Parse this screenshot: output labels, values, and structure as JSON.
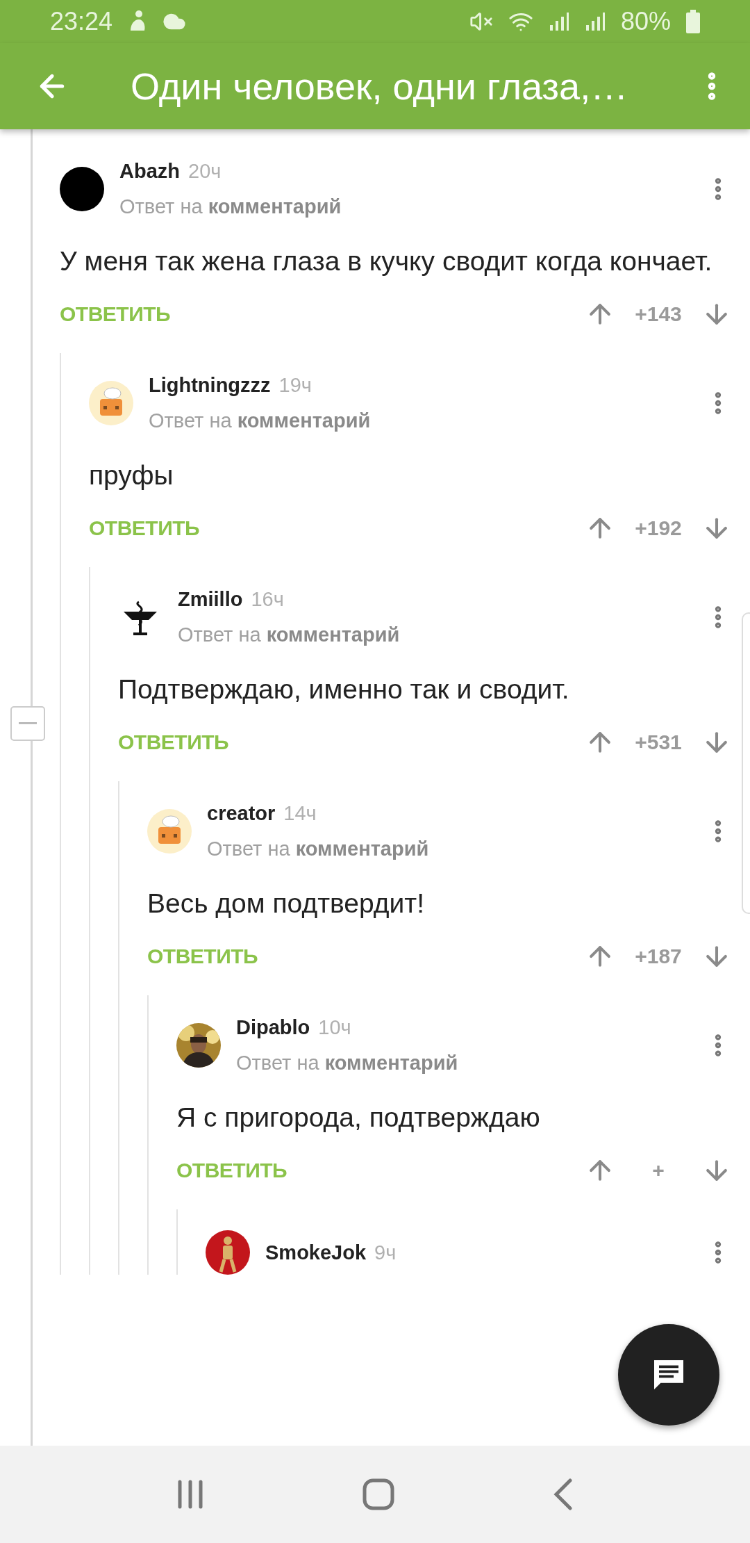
{
  "status_bar": {
    "time": "23:24",
    "battery": "80%"
  },
  "toolbar": {
    "title": "Один человек, одни глаза,…"
  },
  "comments": [
    {
      "author": "Abazh",
      "time": "20ч",
      "avatar": {
        "kind": "dark"
      },
      "reply_line": "Ответ на **комментарий**",
      "text": "У меня так жена глаза в кучку сводит когда кончает.",
      "reply_button": "ОТВЕТИТЬ",
      "score": "+143",
      "children": [
        {
          "author": "Lightningzzz",
          "time": "19ч",
          "avatar": {
            "kind": "house"
          },
          "reply_line": "Ответ на **комментарий**",
          "text": "пруфы",
          "reply_button": "ОТВЕТИТЬ",
          "score": "+192",
          "children": [
            {
              "author": "Zmiillo",
              "time": "16ч",
              "avatar": {
                "kind": "bowl"
              },
              "reply_line": "Ответ на **комментарий**",
              "text": "Подтверждаю, именно так и сводит.",
              "reply_button": "ОТВЕТИТЬ",
              "score": "+531",
              "children": [
                {
                  "author": "creator",
                  "time": "14ч",
                  "avatar": {
                    "kind": "house"
                  },
                  "reply_line": "Ответ на **комментарий**",
                  "text": "Весь дом подтвердит!",
                  "reply_button": "ОТВЕТИТЬ",
                  "score": "+187",
                  "children": [
                    {
                      "author": "Dipablo",
                      "time": "10ч",
                      "reply_line": "Ответ на **комментарий**",
                      "text": "Я с пригорода, подтверждаю",
                      "reply_button": "ОТВЕТИТЬ",
                      "score": "+",
                      "children": [
                        {
                          "author": "SmokeJok",
                          "time": "9ч",
                          "avatar": {
                            "kind": "figure"
                          }
                        }
                      ]
                    }
                  ]
                }
              ]
            }
          ]
        }
      ]
    }
  ]
}
